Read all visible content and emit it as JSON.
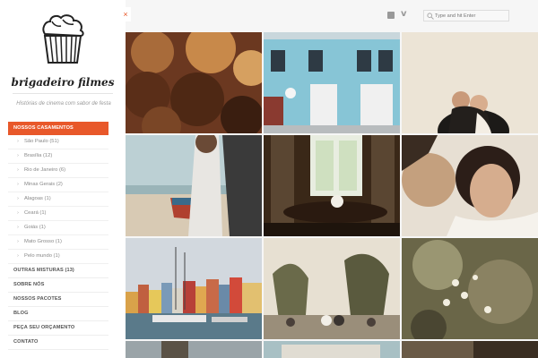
{
  "logo": {
    "text": "brigadeiro filmes"
  },
  "tagline": "Histórias de cinema com sabor de festa",
  "nav": {
    "active": "NOSSOS CASAMENTOS",
    "subitems": [
      "São Paulo (51)",
      "Brasília (12)",
      "Rio de Janeiro (6)",
      "Minas Gerais (2)",
      "Alagoas (1)",
      "Ceará (1)",
      "Goiás (1)",
      "Mato Grosso (1)",
      "Pelo mundo (1)"
    ],
    "items": [
      "OUTRAS MISTURAS (13)",
      "SOBRE NÓS",
      "NOSSOS PACOTES",
      "BLOG",
      "PEÇA SEU ORÇAMENTO",
      "CONTATO"
    ]
  },
  "close_icon": "close-icon",
  "social": {
    "facebook_icon": "facebook-icon",
    "vimeo_icon": "vimeo-icon",
    "vimeo_glyph": "v"
  },
  "search": {
    "placeholder": "Type and hit Enter"
  },
  "colors": {
    "accent": "#e8582a"
  }
}
